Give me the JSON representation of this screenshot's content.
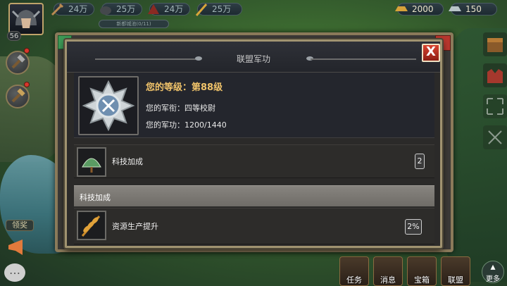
{
  "topbar": {
    "resources": [
      {
        "icon": "sword-resource-icon",
        "value": "24万"
      },
      {
        "icon": "pot-resource-icon",
        "value": "25万"
      },
      {
        "icon": "ore-resource-icon",
        "value": "24万"
      },
      {
        "icon": "wheat-resource-icon",
        "value": "25万"
      }
    ],
    "gold": {
      "icon": "gold-ingot-icon",
      "value": "2000"
    },
    "silver": {
      "icon": "silver-ingot-icon",
      "value": "150"
    },
    "player_level": "56",
    "subbar_text": "新都城池(0/11)"
  },
  "left_side": {
    "reward_label": "领奖"
  },
  "dialog": {
    "title": "联盟军功",
    "close_glyph": "X",
    "level_text": "您的等级：第88级",
    "rank_text": "您的军衔：四等校尉",
    "merit_text": "您的军功：1200/1440",
    "tech_row": {
      "label": "科技加成",
      "value": "2"
    },
    "section_title": "科技加成",
    "resource_row": {
      "label": "资源生产提升",
      "value": "2%"
    }
  },
  "bottom_bar": {
    "buttons": [
      "任务",
      "消息",
      "宝箱",
      "联盟"
    ],
    "more": "更多"
  },
  "colors": {
    "dialog_border": "#a09370",
    "level_text": "#f0c36a",
    "close_red": "#d8432f"
  }
}
